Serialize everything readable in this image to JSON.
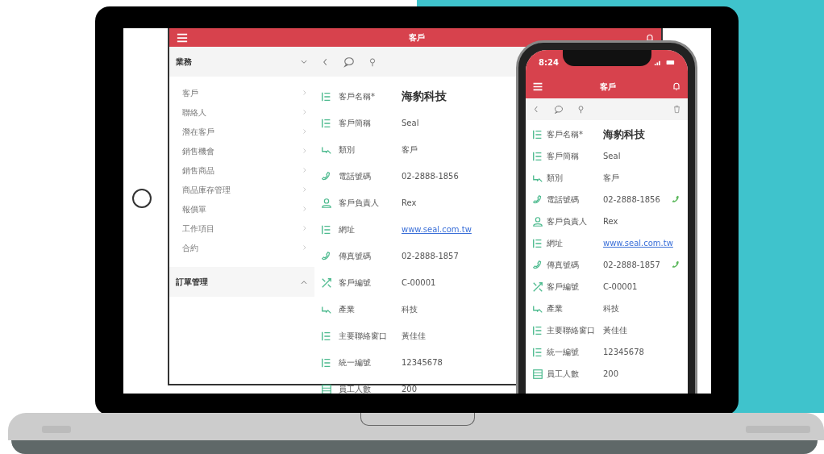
{
  "laptop_app": {
    "title": "客戶",
    "sidebar": [
      {
        "label": "業務",
        "expanded": true,
        "items": [
          "客戶",
          "聯絡人",
          "潛在客戶",
          "銷售機會",
          "銷售商品",
          "商品庫存管理",
          "報價單",
          "工作項目",
          "合約"
        ]
      },
      {
        "label": "訂單管理",
        "expanded": false
      }
    ],
    "fields": [
      {
        "kind": "name",
        "label": "客戶名稱*",
        "value": "海豹科技"
      },
      {
        "kind": "text",
        "label": "客戶簡稱",
        "value": "Seal"
      },
      {
        "kind": "category",
        "label": "類別",
        "value": "客戶"
      },
      {
        "kind": "phone",
        "label": "電話號碼",
        "value": "02-2888-1856"
      },
      {
        "kind": "person",
        "label": "客戶負責人",
        "value": "Rex"
      },
      {
        "kind": "link",
        "label": "網址",
        "value": "www.seal.com.tw"
      },
      {
        "kind": "phone",
        "label": "傳真號碼",
        "value": "02-2888-1857"
      },
      {
        "kind": "code",
        "label": "客戶編號",
        "value": "C-00001"
      },
      {
        "kind": "category",
        "label": "產業",
        "value": "科技"
      },
      {
        "kind": "text",
        "label": "主要聯絡窗口",
        "value": "黃佳佳"
      },
      {
        "kind": "text",
        "label": "統一編號",
        "value": "12345678"
      },
      {
        "kind": "count",
        "label": "員工人數",
        "value": "200"
      }
    ]
  },
  "phone_app": {
    "time": "8:24",
    "title": "客戶",
    "fields": [
      {
        "kind": "name",
        "label": "客戶名稱*",
        "value": "海豹科技",
        "callable": false
      },
      {
        "kind": "text",
        "label": "客戶簡稱",
        "value": "Seal",
        "callable": false
      },
      {
        "kind": "category",
        "label": "類別",
        "value": "客戶",
        "callable": false
      },
      {
        "kind": "phone",
        "label": "電話號碼",
        "value": "02-2888-1856",
        "callable": true
      },
      {
        "kind": "person",
        "label": "客戶負責人",
        "value": "Rex",
        "callable": false
      },
      {
        "kind": "link",
        "label": "網址",
        "value": "www.seal.com.tw",
        "callable": false
      },
      {
        "kind": "phone",
        "label": "傳真號碼",
        "value": "02-2888-1857",
        "callable": true
      },
      {
        "kind": "code",
        "label": "客戶編號",
        "value": "C-00001",
        "callable": false
      },
      {
        "kind": "category",
        "label": "產業",
        "value": "科技",
        "callable": false
      },
      {
        "kind": "text",
        "label": "主要聯絡窗口",
        "value": "黃佳佳",
        "callable": false
      },
      {
        "kind": "text",
        "label": "統一編號",
        "value": "12345678",
        "callable": false
      },
      {
        "kind": "count",
        "label": "員工人數",
        "value": "200",
        "callable": false
      }
    ]
  }
}
